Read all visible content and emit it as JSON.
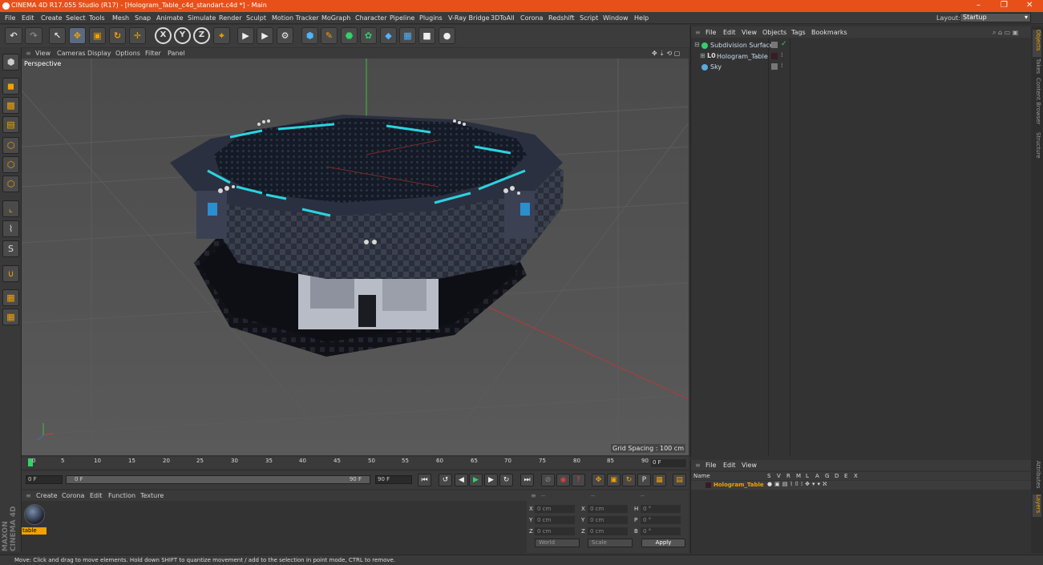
{
  "window": {
    "title": "CINEMA 4D R17.055 Studio (R17) - [Hologram_Table_c4d_standart.c4d *] - Main",
    "minimize": "–",
    "restore": "❐",
    "close": "✕"
  },
  "menubar": {
    "items": [
      "File",
      "Edit",
      "Create",
      "Select",
      "Tools",
      "Mesh",
      "Snap",
      "Animate",
      "Simulate",
      "Render",
      "Sculpt",
      "Motion Tracker",
      "MoGraph",
      "Character",
      "Pipeline",
      "Plugins",
      "V-Ray Bridge",
      "3DToAll",
      "Corona",
      "Redshift",
      "Script",
      "Window",
      "Help"
    ],
    "layout_label": "Layout:",
    "layout_value": "Startup"
  },
  "toolbar": {
    "axis_x": "X",
    "axis_y": "Y",
    "axis_z": "Z"
  },
  "viewport": {
    "menu": [
      "View",
      "Cameras",
      "Display",
      "Options",
      "Filter",
      "Panel"
    ],
    "label": "Perspective",
    "grid_spacing": "Grid Spacing : 100 cm"
  },
  "timeline": {
    "ticks": [
      "0",
      "5",
      "10",
      "15",
      "20",
      "25",
      "30",
      "35",
      "40",
      "45",
      "50",
      "55",
      "60",
      "65",
      "70",
      "75",
      "80",
      "85",
      "90"
    ],
    "current_frame": "0 F"
  },
  "transport": {
    "start": "0 F",
    "range_start": "0 F",
    "range_end": "90 F",
    "end": "90 F"
  },
  "material_manager": {
    "menu": [
      "Create",
      "Corona",
      "Edit",
      "Function",
      "Texture"
    ],
    "materials": [
      {
        "name": "table"
      }
    ]
  },
  "branding": {
    "text": "MAXON CINEMA 4D"
  },
  "coordinates": {
    "header": [
      "--",
      "--",
      "--"
    ],
    "rows": [
      {
        "a": "X",
        "av": "0 cm",
        "b": "X",
        "bv": "0 cm",
        "c": "H",
        "cv": "0 °"
      },
      {
        "a": "Y",
        "av": "0 cm",
        "b": "Y",
        "bv": "0 cm",
        "c": "P",
        "cv": "0 °"
      },
      {
        "a": "Z",
        "av": "0 cm",
        "b": "Z",
        "bv": "0 cm",
        "c": "B",
        "cv": "0 °"
      }
    ],
    "mode": "World",
    "scale": "Scale",
    "apply": "Apply"
  },
  "status": "Move: Click and drag to move elements. Hold down SHIFT to quantize movement / add to the selection in point mode, CTRL to remove.",
  "objects": {
    "menu": [
      "File",
      "Edit",
      "View",
      "Objects",
      "Tags",
      "Bookmarks"
    ],
    "items": [
      {
        "name": "Subdivision Surface"
      },
      {
        "name": "Hologram_Table"
      },
      {
        "name": "Sky"
      }
    ]
  },
  "sidetabs": [
    "Objects",
    "Takes",
    "Content Browser",
    "Structure",
    "Attributes",
    "Layers"
  ],
  "layers": {
    "menu": [
      "File",
      "Edit",
      "View"
    ],
    "header": [
      "Name",
      "S",
      "V",
      "R",
      "M",
      "L",
      "A",
      "G",
      "D",
      "E",
      "X"
    ],
    "items": [
      {
        "name": "Hologram_Table"
      }
    ]
  },
  "colors": {
    "accent": "#f2a100",
    "titlebar": "#e8501a",
    "hologram": "#2ad4e0"
  }
}
